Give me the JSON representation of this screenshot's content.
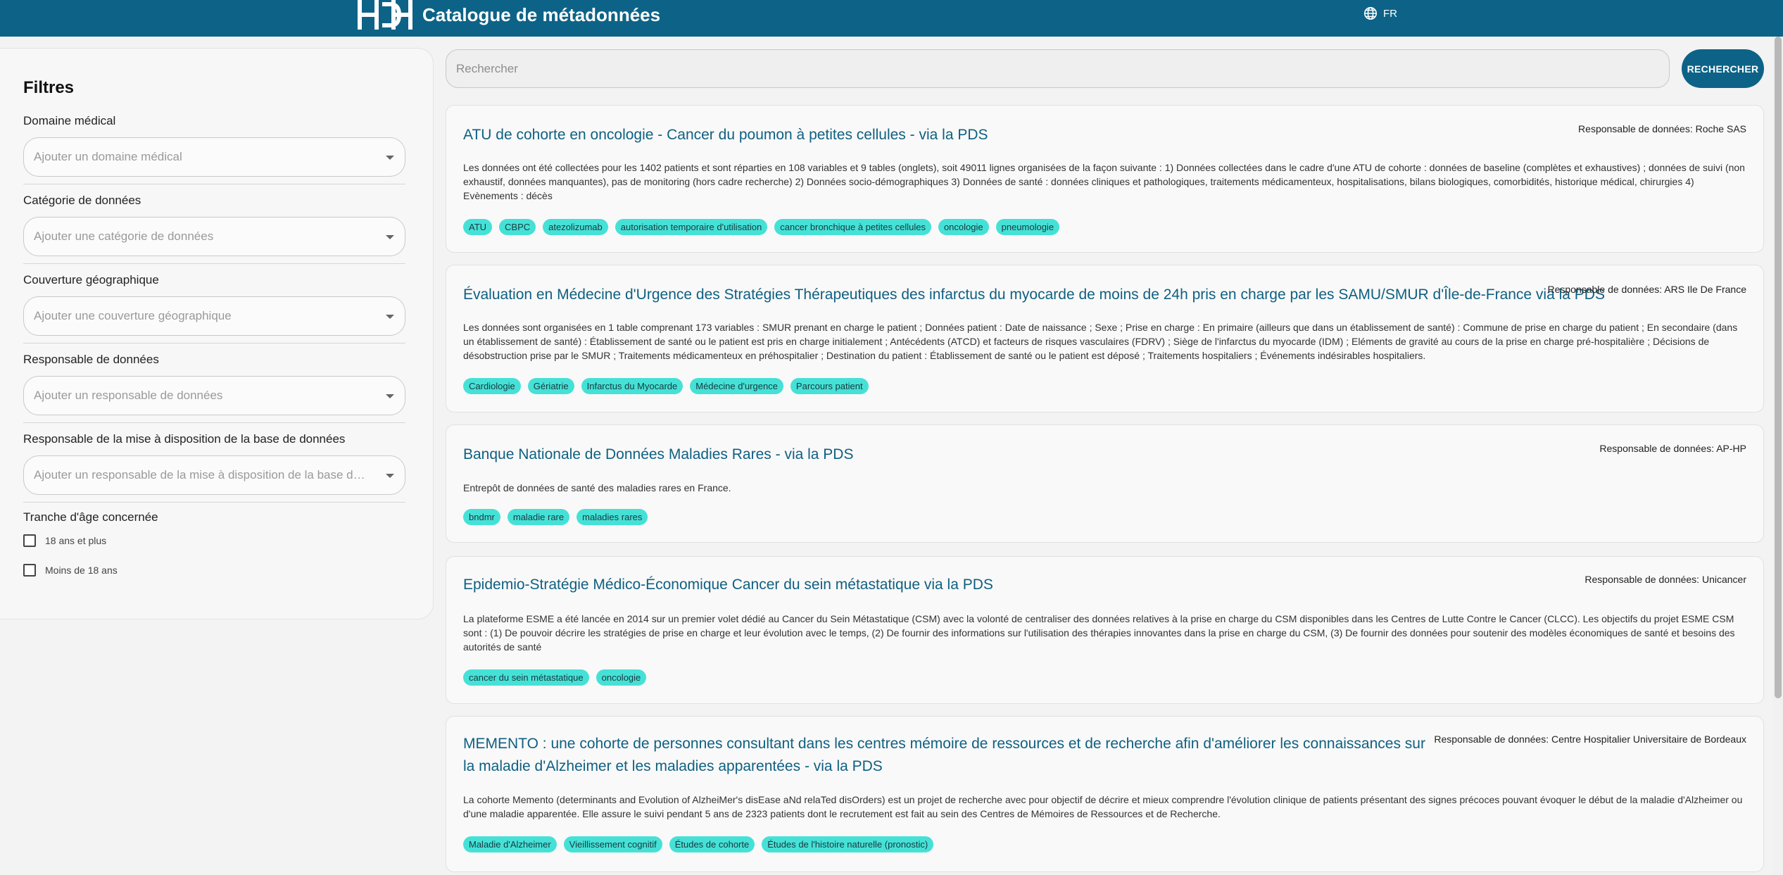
{
  "header": {
    "title": "Catalogue de métadonnées",
    "language": "FR",
    "logo_text": "HDH"
  },
  "filters": {
    "title": "Filtres",
    "groups": [
      {
        "label": "Domaine médical",
        "placeholder": "Ajouter un domaine médical"
      },
      {
        "label": "Catégorie de données",
        "placeholder": "Ajouter une catégorie de données"
      },
      {
        "label": "Couverture géographique",
        "placeholder": "Ajouter une couverture géographique"
      },
      {
        "label": "Responsable de données",
        "placeholder": "Ajouter un responsable de données"
      },
      {
        "label": "Responsable de la mise à disposition de la base de données",
        "placeholder": "Ajouter un responsable de la mise à disposition de la base de don..."
      }
    ],
    "age": {
      "title": "Tranche d'âge concernée",
      "options": [
        "18 ans et plus",
        "Moins de 18 ans"
      ]
    }
  },
  "search": {
    "placeholder": "Rechercher",
    "button": "RECHERCHER"
  },
  "results": [
    {
      "title": "ATU de cohorte en oncologie - Cancer du poumon à petites cellules - via la PDS",
      "responsible": "Responsable de données: Roche SAS",
      "description": "Les données ont été collectées pour les 1402 patients et sont réparties en 108 variables et 9 tables (onglets), soit 49011 lignes organisées de la façon suivante : 1) Données collectées dans le cadre d'une ATU de cohorte : données de baseline (complètes et exhaustives) ; données de suivi (non exhaustif, données manquantes), pas de monitoring (hors cadre recherche) 2) Données socio-démographiques 3) Données de santé : données cliniques et pathologiques, traitements médicamenteux, hospitalisations, bilans biologiques, comorbidités, historique médical, chirurgies 4) Evènements : décès",
      "tags": [
        "ATU",
        "CBPC",
        "atezolizumab",
        "autorisation temporaire d'utilisation",
        "cancer bronchique à petites cellules",
        "oncologie",
        "pneumologie"
      ]
    },
    {
      "title": "Évaluation en Médecine d'Urgence des Stratégies Thérapeutiques des infarctus du myocarde de moins de 24h pris en charge par les SAMU/SMUR d'Île-de-France via la PDS",
      "responsible": "Responsable de données: ARS Ile De France",
      "description": "Les données sont organisées en 1 table comprenant 173 variables : SMUR prenant en charge le patient ; Données patient : Date de naissance ; Sexe ; Prise en charge : En primaire (ailleurs que dans un établissement de santé) : Commune de prise en charge du patient ; En secondaire (dans un établissement de santé) : Établissement de santé ou le patient est pris en charge initialement ; Antécédents (ATCD) et facteurs de risques vasculaires (FDRV) ; Siège de l'infarctus du myocarde (IDM) ; Eléments de gravité au cours de la prise en charge pré-hospitalière ; Décisions de désobstruction prise par le SMUR ; Traitements médicamenteux en préhospitalier ; Destination du patient : Établissement de santé ou le patient est déposé ; Traitements hospitaliers ; Événements indésirables hospitaliers.",
      "tags": [
        "Cardiologie",
        "Gériatrie",
        "Infarctus du Myocarde",
        "Médecine d'urgence",
        "Parcours patient"
      ]
    },
    {
      "title": "Banque Nationale de Données Maladies Rares - via la PDS",
      "responsible": "Responsable de données: AP-HP",
      "description": "Entrepôt de données de santé des maladies rares en France.",
      "tags": [
        "bndmr",
        "maladie rare",
        "maladies rares"
      ]
    },
    {
      "title": "Epidemio-Stratégie Médico-Économique Cancer du sein métastatique via la PDS",
      "responsible": "Responsable de données: Unicancer",
      "description": "La plateforme ESME a été lancée en 2014 sur un premier volet dédié au Cancer du Sein Métastatique (CSM) avec la volonté de centraliser des données relatives à la prise en charge du CSM disponibles dans les Centres de Lutte Contre le Cancer (CLCC). Les objectifs du projet ESME CSM sont : (1) De pouvoir décrire les stratégies de prise en charge et leur évolution avec le temps, (2) De fournir des informations sur l'utilisation des thérapies innovantes dans la prise en charge du CSM, (3) De fournir des données pour soutenir des modèles économiques de santé et besoins des autorités de santé",
      "tags": [
        "cancer du sein métastatique",
        "oncologie"
      ]
    },
    {
      "title": "MEMENTO : une cohorte de personnes consultant dans les centres mémoire de ressources et de recherche afin d'améliorer les connaissances sur la maladie d'Alzheimer et les maladies apparentées - via la PDS",
      "responsible": "Responsable de données: Centre Hospitalier Universitaire de Bordeaux",
      "description": "La cohorte Memento (determinants and Evolution of AlzheiMer's disEase aNd relaTed disOrders) est un projet de recherche avec pour objectif de décrire et mieux comprendre l'évolution clinique de patients présentant des signes précoces pouvant évoquer le début de la maladie d'Alzheimer ou d'une maladie apparentée. Elle assure le suivi pendant 5 ans de 2323 patients dont le recrutement est fait au sein des Centres de Mémoires de Ressources et de Recherche.",
      "tags": [
        "Maladie d'Alzheimer",
        "Vieillissement cognitif",
        "Études de cohorte",
        "Études de l'histoire naturelle (pronostic)"
      ]
    }
  ]
}
